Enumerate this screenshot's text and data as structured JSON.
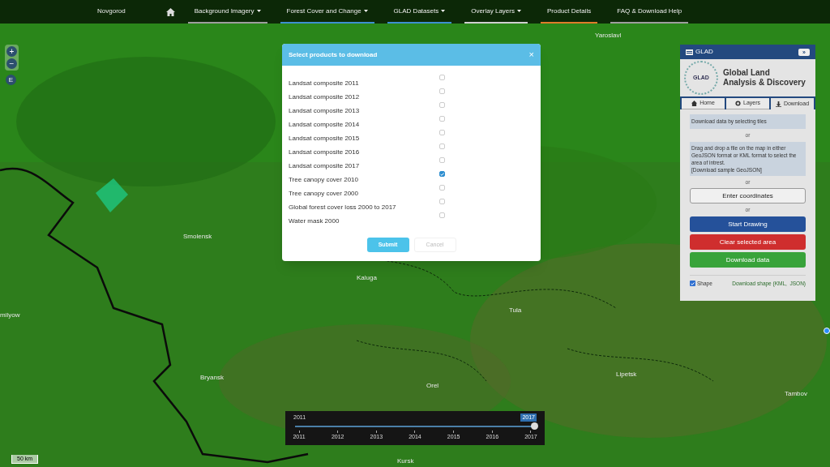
{
  "nav": {
    "items": [
      {
        "label": "Background Imagery",
        "dropdown": true,
        "color": "#9e9e9e"
      },
      {
        "label": "Forest Cover and Change",
        "dropdown": true,
        "color": "#3d8fd1"
      },
      {
        "label": "GLAD Datasets",
        "dropdown": true,
        "color": "#3d8fd1"
      },
      {
        "label": "Overlay Layers",
        "dropdown": true,
        "color": "#cfcfcf"
      },
      {
        "label": "Product Details",
        "dropdown": false,
        "color": "#e07b2a"
      },
      {
        "label": "FAQ & Download Help",
        "dropdown": false,
        "color": "#9e9e9e"
      }
    ]
  },
  "map": {
    "places": [
      "Novgorod",
      "Yaroslavl",
      "Smolensk",
      "Kaluga",
      "Tula",
      "milyow",
      "Bryansk",
      "Orel",
      "Lipetsk",
      "Tambov",
      "Kursk"
    ],
    "zoom_controls": [
      "+",
      "−"
    ],
    "edit_button": "E",
    "scale": "50 km"
  },
  "dialog": {
    "title": "Select products to download",
    "close": "×",
    "products": [
      {
        "label": "Landsat composite 2011",
        "checked": false
      },
      {
        "label": "Landsat composite 2012",
        "checked": false
      },
      {
        "label": "Landsat composite 2013",
        "checked": false
      },
      {
        "label": "Landsat composite 2014",
        "checked": false
      },
      {
        "label": "Landsat composite 2015",
        "checked": false
      },
      {
        "label": "Landsat composite 2016",
        "checked": false
      },
      {
        "label": "Landsat composite 2017",
        "checked": false
      },
      {
        "label": "Tree canopy cover 2010",
        "checked": true
      },
      {
        "label": "Tree canopy cover 2000",
        "checked": false
      },
      {
        "label": "Global forest cover loss 2000 to 2017",
        "checked": false
      },
      {
        "label": "Water mask 2000",
        "checked": false
      }
    ],
    "buttons": [
      "Submit",
      "Cancel"
    ]
  },
  "panel": {
    "title": "GLAD",
    "collapse": "»",
    "logo_text": "GLAD",
    "heading": [
      "Global Land",
      "Analysis & Discovery"
    ],
    "tabs": [
      {
        "label": "Home",
        "selected": false
      },
      {
        "label": "Layers",
        "selected": false
      },
      {
        "label": "Download",
        "selected": true
      }
    ],
    "info": "Download data by selecting tiles",
    "or": [
      "or",
      "or",
      "or"
    ],
    "drop_info": [
      "Drag and drop a file on the map in either GeoJSON format or KML format to select the area of intrest.",
      "[Download sample GeoJSON]"
    ],
    "buttons": [
      {
        "label": "Enter coordinates",
        "kind": "default"
      },
      {
        "label": "Start Drawing",
        "kind": "primary"
      },
      {
        "label": "Clear selected area",
        "kind": "danger"
      },
      {
        "label": "Download data",
        "kind": "success"
      }
    ],
    "shape": {
      "label": "Shape",
      "checked": true
    },
    "download_shape": "Download shape (KML,  JSON)"
  },
  "slider": {
    "min_label": "2011",
    "value_label": "2017",
    "level": 1.0,
    "ticks": [
      "2011",
      "2012",
      "2013",
      "2014",
      "2015",
      "2016",
      "2017"
    ]
  }
}
